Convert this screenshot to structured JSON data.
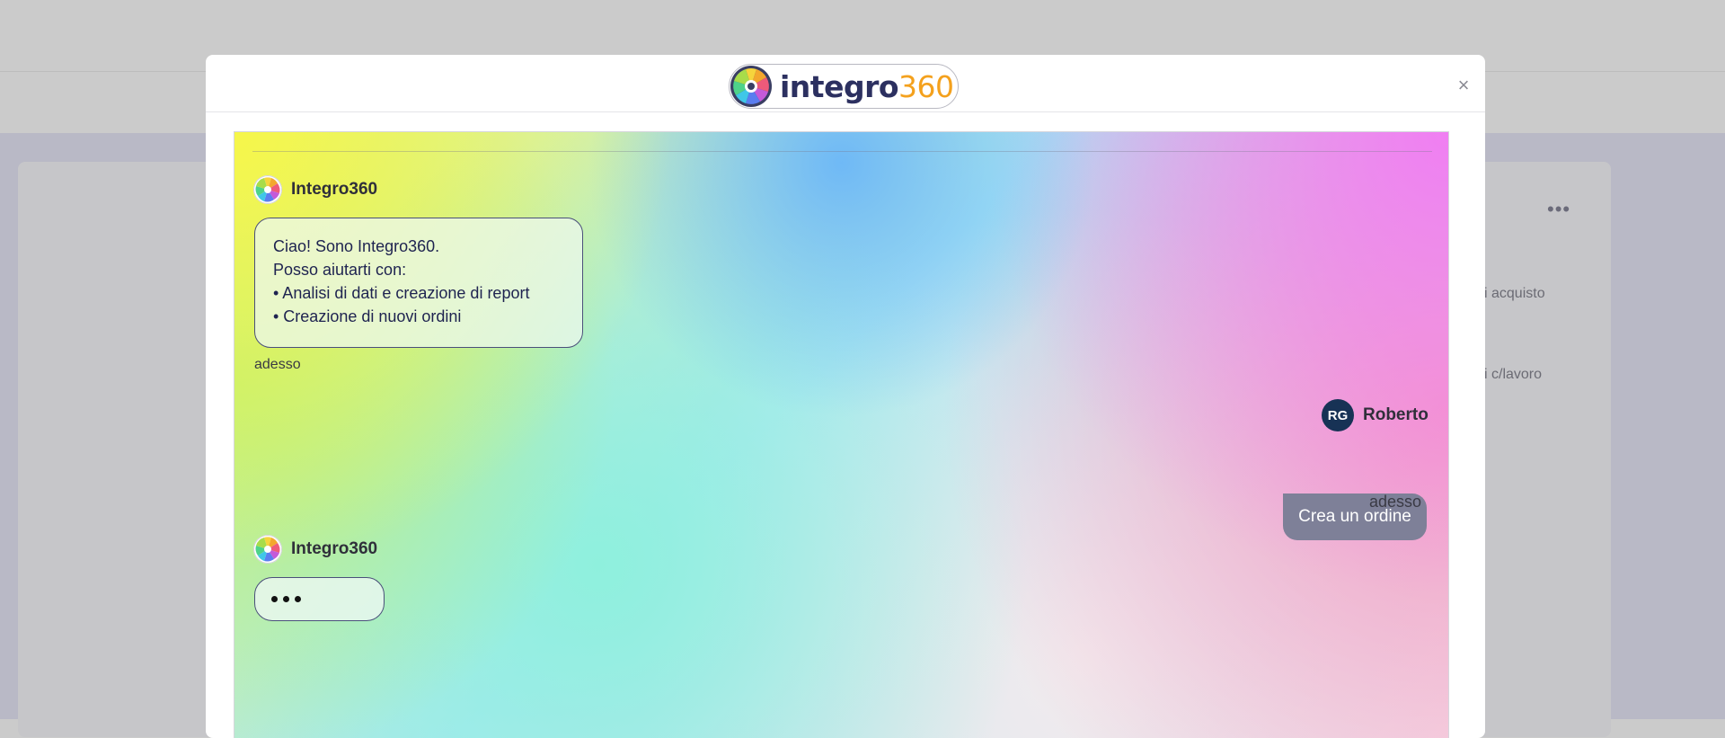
{
  "background_app": {
    "menu_dots": "•••",
    "text_1": "i acquisto",
    "text_2": "i c/lavoro"
  },
  "modal": {
    "logo": {
      "text": "integro",
      "number": "360"
    },
    "close_label": "×"
  },
  "chat": {
    "messages": [
      {
        "sender": "Integro360",
        "lines": [
          "Ciao! Sono Integro360.",
          "Posso aiutarti con:",
          "• Analisi di dati e creazione di report",
          "• Creazione di nuovi ordini"
        ],
        "time": "adesso"
      },
      {
        "sender": "Roberto",
        "initials": "RG",
        "text": "Crea un ordine",
        "time": "adesso"
      },
      {
        "sender": "Integro360",
        "typing": true
      }
    ]
  },
  "colors": {
    "logo_text": "#2c3060",
    "logo_number": "#f4a11d",
    "user_avatar": "#173255",
    "user_bubble": "#7e8098",
    "bubble_border": "#4a4f7a"
  }
}
